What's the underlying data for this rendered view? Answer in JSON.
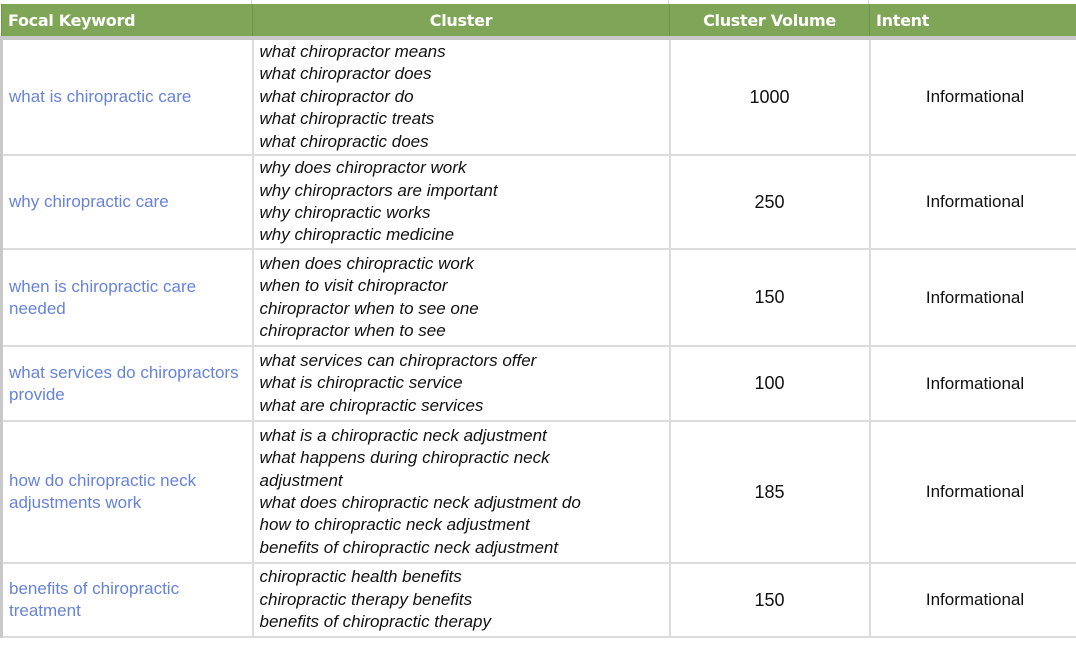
{
  "table": {
    "headers": {
      "focal_keyword": "Focal Keyword",
      "cluster": "Cluster",
      "cluster_volume": "Cluster Volume",
      "intent": "Intent"
    },
    "header_color": "#7ea656",
    "link_color": "#6683d9",
    "rows": [
      {
        "focal_keyword": "what is chiropractic care",
        "cluster": [
          "what chiropractor means",
          "what chiropractor does",
          "what chiropractor do",
          "what chiropractic treats",
          "what chiropractic does"
        ],
        "cluster_volume": "1000",
        "intent": "Informational"
      },
      {
        "focal_keyword": "why chiropractic care",
        "cluster": [
          "why does chiropractor work",
          "why chiropractors are important",
          "why chiropractic works",
          "why chiropractic medicine"
        ],
        "cluster_volume": "250",
        "intent": "Informational"
      },
      {
        "focal_keyword": "when is chiropractic care needed",
        "cluster": [
          "when does chiropractic work",
          "when to visit chiropractor",
          "chiropractor when to see one",
          "chiropractor when to see"
        ],
        "cluster_volume": "150",
        "intent": "Informational"
      },
      {
        "focal_keyword": "what services do chiropractors provide",
        "cluster": [
          "what services can chiropractors offer",
          "what is chiropractic service",
          "what are chiropractic services"
        ],
        "cluster_volume": "100",
        "intent": "Informational"
      },
      {
        "focal_keyword": "how do chiropractic neck adjustments work",
        "cluster": [
          "what is a chiropractic neck adjustment",
          "what happens during chiropractic neck adjustment",
          "what does chiropractic neck adjustment do",
          "how to chiropractic neck adjustment",
          "benefits of chiropractic neck adjustment"
        ],
        "cluster_volume": "185",
        "intent": "Informational"
      },
      {
        "focal_keyword": "benefits of chiropractic treatment",
        "cluster": [
          "chiropractic health benefits",
          "chiropractic therapy benefits",
          "benefits of chiropractic therapy"
        ],
        "cluster_volume": "150",
        "intent": "Informational"
      }
    ]
  }
}
